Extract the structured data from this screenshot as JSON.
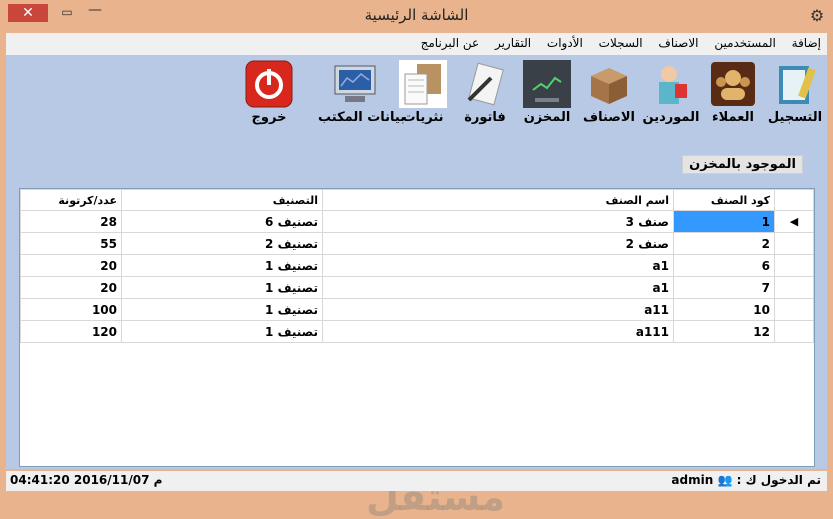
{
  "window": {
    "title": "الشاشة الرئيسية",
    "close": "✕",
    "maximize": "▭",
    "minimize": "—"
  },
  "menu": [
    "إضافة",
    "المستخدمين",
    "الاصناف",
    "السجلات",
    "الأدوات",
    "التقارير",
    "عن البرنامج"
  ],
  "toolbar": [
    {
      "label": "التسجيل",
      "icon": "registration-book-icon"
    },
    {
      "label": "العملاء",
      "icon": "customers-icon"
    },
    {
      "label": "الموردين",
      "icon": "suppliers-icon"
    },
    {
      "label": "الاصناف",
      "icon": "box-icon"
    },
    {
      "label": "المخزن",
      "icon": "stocks-chart-icon"
    },
    {
      "label": "فاتورة",
      "icon": "invoice-pen-icon"
    },
    {
      "label": "نثريات",
      "icon": "misc-expenses-icon"
    },
    {
      "label": "بيانات المكتب",
      "icon": "office-monitor-icon"
    },
    {
      "label": "خروج",
      "icon": "power-exit-icon"
    }
  ],
  "section_title": "الموجود بالمخزن",
  "grid": {
    "columns": [
      "كود الصنف",
      "اسم الصنف",
      "التصنيف",
      "عدد/كرتونة"
    ],
    "rows": [
      {
        "code": "1",
        "name": "صنف 3",
        "category": "تصنيف 6",
        "count": "28"
      },
      {
        "code": "2",
        "name": "صنف 2",
        "category": "تصنيف 2",
        "count": "55"
      },
      {
        "code": "6",
        "name": "a1",
        "category": "تصنيف 1",
        "count": "20"
      },
      {
        "code": "7",
        "name": "a1",
        "category": "تصنيف 1",
        "count": "20"
      },
      {
        "code": "10",
        "name": "a11",
        "category": "تصنيف 1",
        "count": "100"
      },
      {
        "code": "12",
        "name": "a111",
        "category": "تصنيف 1",
        "count": "120"
      }
    ]
  },
  "status": {
    "login_label": "تم الدخول ك :",
    "user": "admin",
    "datetime": "04:41:20 2016/11/07 م"
  },
  "watermark": "مستقل"
}
